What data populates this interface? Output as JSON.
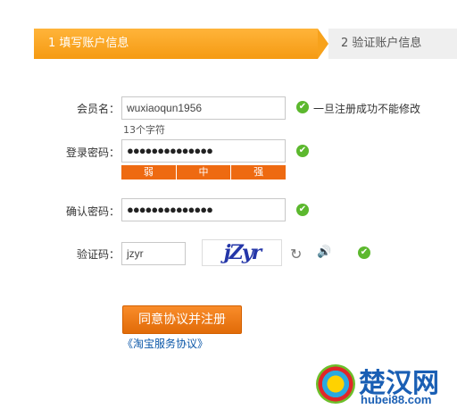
{
  "steps": {
    "step1": "1 填写账户信息",
    "step2": "2 验证账户信息"
  },
  "form": {
    "username": {
      "label": "会员名：",
      "value": "wuxiaoqun1956",
      "hint": "一旦注册成功不能修改",
      "char_count": "13个字符"
    },
    "password": {
      "label": "登录密码：",
      "value": "●●●●●●●●●●●●●●",
      "strength": [
        "弱",
        "中",
        "强"
      ]
    },
    "confirm": {
      "label": "确认密码：",
      "value": "●●●●●●●●●●●●●●"
    },
    "captcha": {
      "label": "验证码：",
      "value": "jzyr",
      "image_text": "jZyr"
    }
  },
  "actions": {
    "submit": "同意协议并注册",
    "agreement_link": "《淘宝服务协议》"
  },
  "icons": {
    "check": "✔",
    "refresh": "↻",
    "audio": "🔊"
  },
  "watermark": {
    "name": "楚汉网",
    "url": "hubei88.com"
  }
}
